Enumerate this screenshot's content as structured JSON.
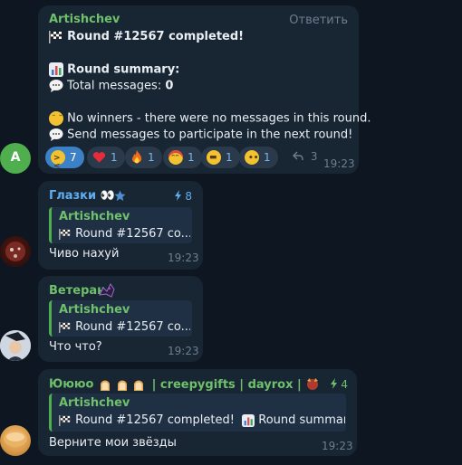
{
  "messages": [
    {
      "author": "Artishchev",
      "reply_action": "Ответить",
      "lines": [
        "Round #12567 completed!",
        "",
        "Round summary:",
        "Total messages:",
        "0",
        "",
        "No winners - there were no messages in this round.",
        "Send messages to participate in the next round!"
      ],
      "avatar_letter": "A",
      "reactions": [
        {
          "emoji": "rofl-icon",
          "count": "7"
        },
        {
          "emoji": "heart-icon",
          "count": "1"
        },
        {
          "emoji": "fire-icon",
          "count": "1"
        },
        {
          "emoji": "party-face-icon",
          "count": "1"
        },
        {
          "emoji": "grin-icon",
          "count": "1"
        },
        {
          "emoji": "neutral-face-icon",
          "count": "1"
        }
      ],
      "reply_count": "3",
      "time": "19:23"
    },
    {
      "author": "Глазки 👀",
      "badge_count": "8",
      "reply_to": {
        "author": "Artishchev",
        "text": "Round #12567 co..."
      },
      "text": "Чиво нахуй",
      "time": "19:23"
    },
    {
      "author": "Ветеран",
      "reply_to": {
        "author": "Artishchev",
        "text": "Round #12567 co..."
      },
      "text": "Что что?",
      "time": "19:23"
    },
    {
      "author": "Юююо",
      "author_suffix": "| creepygifts | dayrox |",
      "badge_count": "4",
      "reply_to": {
        "author": "Artishchev",
        "text": "Round #12567 completed!",
        "text2": "Round summar..."
      },
      "text": "Верните мои звёзды",
      "time": "19:23"
    }
  ],
  "colors": {
    "background": "#0e1621",
    "bubble": "#182533",
    "accent_green": "#6fc06c",
    "accent_blue": "#3c80c6",
    "name_blue": "#5eaef0"
  }
}
